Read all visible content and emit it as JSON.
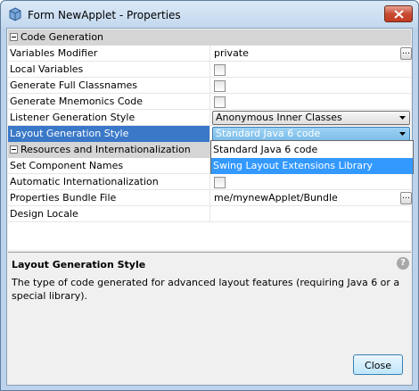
{
  "window": {
    "title": "Form NewApplet - Properties"
  },
  "sections": {
    "code_generation": "Code Generation",
    "resources": "Resources and Internationalization"
  },
  "props": {
    "variables_modifier": {
      "name": "Variables Modifier",
      "value": "private"
    },
    "local_variables": {
      "name": "Local Variables"
    },
    "full_classnames": {
      "name": "Generate Full Classnames"
    },
    "mnemonics": {
      "name": "Generate Mnemonics Code"
    },
    "listener_style": {
      "name": "Listener Generation Style",
      "value": "Anonymous Inner Classes"
    },
    "layout_style": {
      "name": "Layout Generation Style",
      "value": "Standard Java 6 code"
    },
    "set_component_names": {
      "name": "Set Component Names"
    },
    "auto_i18n": {
      "name": "Automatic Internationalization"
    },
    "bundle_file": {
      "name": "Properties Bundle File",
      "value": "me/mynewApplet/Bundle"
    },
    "design_locale": {
      "name": "Design Locale",
      "value": ""
    }
  },
  "dropdown": {
    "options": [
      "Standard Java 6 code",
      "Swing Layout Extensions Library"
    ],
    "highlighted_index": 1
  },
  "help": {
    "title": "Layout Generation Style",
    "description": "The type of code generated for advanced layout features (requiring Java 6 or a special library).",
    "icon": "?"
  },
  "buttons": {
    "close": "Close"
  },
  "icons": {
    "window": "netbeans-cube-icon",
    "close": "close-x-icon",
    "help": "help-question-icon"
  }
}
